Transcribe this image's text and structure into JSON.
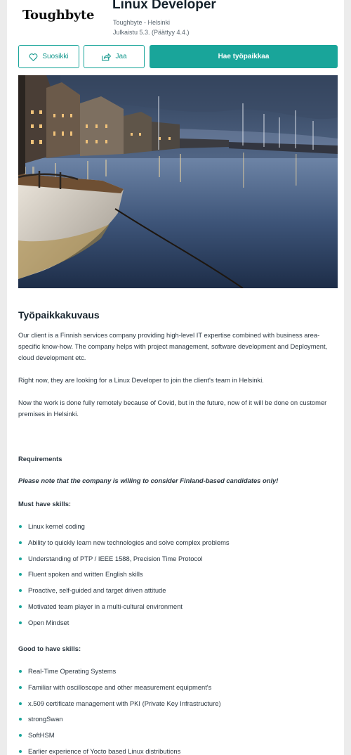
{
  "company": {
    "logo_text": "Toughbyte"
  },
  "job": {
    "title": "Linux Developer",
    "location_line": "Toughbyte - Helsinki",
    "published_line": "Julkaistu 5.3. (Päättyy 4.4.)"
  },
  "actions": {
    "favorite_label": "Suosikki",
    "share_label": "Jaa",
    "apply_label": "Hae työpaikkaa"
  },
  "colors": {
    "accent": "#19a59a",
    "text": "#2a3640",
    "heading": "#14212b"
  },
  "hero_image": {
    "description_icon": "harbor-photo"
  },
  "description": {
    "heading": "Työpaikkakuvaus",
    "paragraphs": [
      "Our client is a Finnish services company providing high-level IT expertise combined with business area-specific know-how. The company helps with project management, software development and Deployment, cloud development etc.",
      "Right now, they are looking for a Linux Developer to join the client's team in Helsinki.",
      "Now the work is done fully remotely because of Covid, but in the future, now of it will be done on customer premises in Helsinki."
    ],
    "requirements_label": "Requirements",
    "note": "Please note that the company is willing to consider Finland-based candidates only!",
    "must_have_label": "Must have skills:",
    "must_have": [
      "Linux kernel coding",
      "Ability to quickly learn new technologies and solve complex problems",
      "Understanding of PTP / IEEE 1588, Precision Time Protocol",
      "Fluent spoken and written English skills",
      "Proactive, self-guided and target driven attitude",
      "Motivated team player in a multi-cultural environment",
      "Open Mindset"
    ],
    "good_to_have_label": "Good to have skills:",
    "good_to_have": [
      "Real-Time Operating Systems",
      "Familiar with oscilloscope and other measurement equipment's",
      "x.509 certificate management with PKI (Private Key Infrastructure)",
      "strongSwan",
      "SoftHSM",
      "Earlier experience of Yocto based Linux distributions"
    ]
  }
}
